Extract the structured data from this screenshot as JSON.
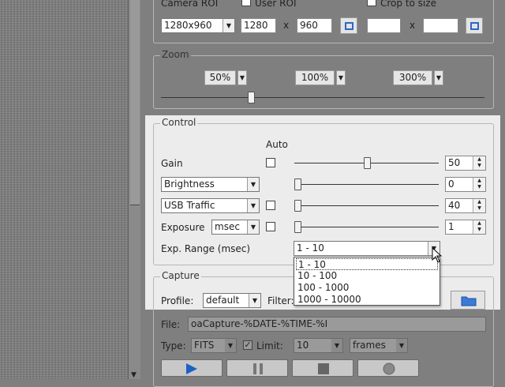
{
  "roi": {
    "camera_label": "Camera ROI",
    "user_label": "User ROI",
    "crop_label": "Crop to size",
    "resolution": "1280x960",
    "width": "1280",
    "height": "960",
    "x_sep": "x",
    "x_sep2": "x",
    "crop_width": "",
    "crop_height": ""
  },
  "zoom": {
    "title": "Zoom",
    "options": [
      "50%",
      "100%",
      "300%"
    ]
  },
  "control": {
    "title": "Control",
    "auto_label": "Auto",
    "gain": {
      "label": "Gain",
      "value": "50",
      "auto": false
    },
    "brightness": {
      "selector": "Brightness",
      "value": "0"
    },
    "usb": {
      "selector": "USB Traffic",
      "value": "40",
      "auto": false
    },
    "exposure": {
      "label": "Exposure",
      "unit": "msec",
      "value": "1",
      "auto": false
    },
    "exp_range": {
      "label": "Exp. Range (msec)",
      "selected": "1 - 10",
      "options": [
        "1 - 10",
        "10 - 100",
        "100 - 1000",
        "1000 - 10000"
      ]
    }
  },
  "capture": {
    "title": "Capture",
    "profile_label": "Profile:",
    "profile_value": "default",
    "filters_label": "Filter:",
    "file_label": "File:",
    "file_value": "oaCapture-%DATE-%TIME-%I",
    "type_label": "Type:",
    "type_value": "FITS",
    "limit_label": "Limit:",
    "limit_checked": true,
    "limit_value": "10",
    "limit_unit": "frames"
  },
  "colors": {
    "accent": "#2b66c8",
    "play": "#1f5fc4",
    "folder": "#3b7bd8"
  }
}
